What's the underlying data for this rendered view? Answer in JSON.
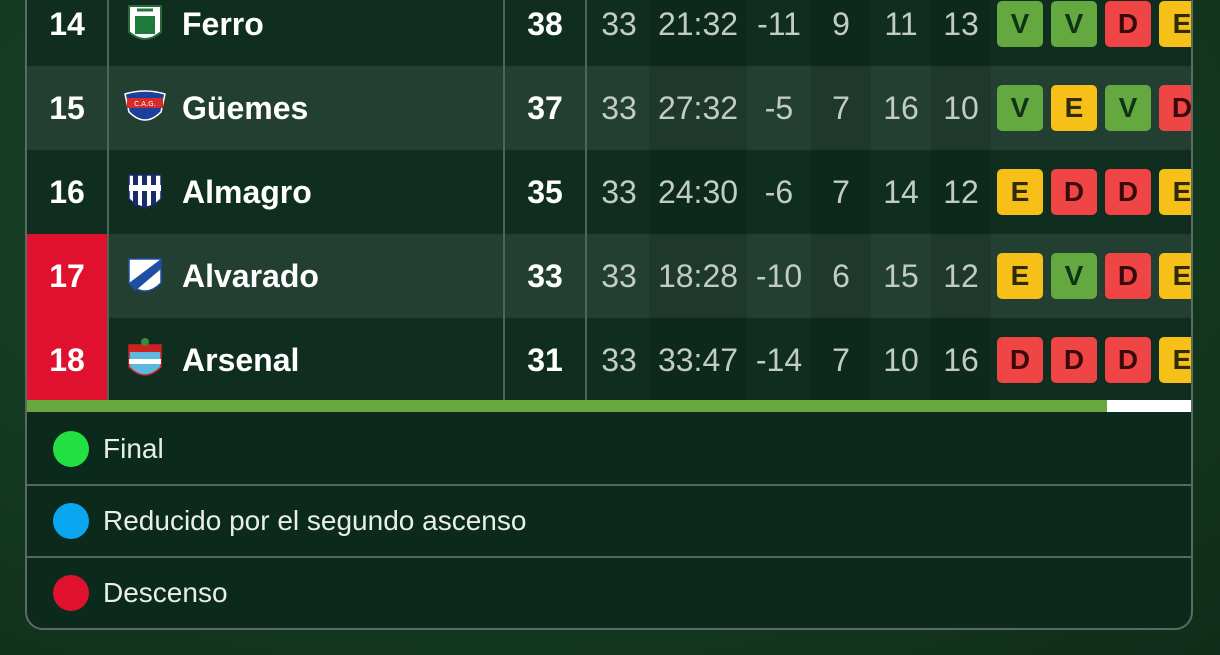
{
  "table": {
    "rows": [
      {
        "pos": "14",
        "team": "Ferro",
        "pts": "38",
        "pj": "33",
        "goals": "21:32",
        "dg": "-11",
        "g": "9",
        "e": "11",
        "p": "13",
        "form": [
          "V",
          "V",
          "D",
          "E"
        ],
        "highlight": false
      },
      {
        "pos": "15",
        "team": "Güemes",
        "pts": "37",
        "pj": "33",
        "goals": "27:32",
        "dg": "-5",
        "g": "7",
        "e": "16",
        "p": "10",
        "form": [
          "V",
          "E",
          "V",
          "D"
        ],
        "highlight": false
      },
      {
        "pos": "16",
        "team": "Almagro",
        "pts": "35",
        "pj": "33",
        "goals": "24:30",
        "dg": "-6",
        "g": "7",
        "e": "14",
        "p": "12",
        "form": [
          "E",
          "D",
          "D",
          "E"
        ],
        "highlight": false
      },
      {
        "pos": "17",
        "team": "Alvarado",
        "pts": "33",
        "pj": "33",
        "goals": "18:28",
        "dg": "-10",
        "g": "6",
        "e": "15",
        "p": "12",
        "form": [
          "E",
          "V",
          "D",
          "E"
        ],
        "highlight": true
      },
      {
        "pos": "18",
        "team": "Arsenal",
        "pts": "31",
        "pj": "33",
        "goals": "33:47",
        "dg": "-14",
        "g": "7",
        "e": "10",
        "p": "16",
        "form": [
          "D",
          "D",
          "D",
          "E"
        ],
        "highlight": true
      }
    ]
  },
  "legend": {
    "items": [
      {
        "label": "Final",
        "color": "#22e041"
      },
      {
        "label": "Reducido por el segundo ascenso",
        "color": "#0aa6ef"
      },
      {
        "label": "Descenso",
        "color": "#e0112f"
      }
    ]
  }
}
